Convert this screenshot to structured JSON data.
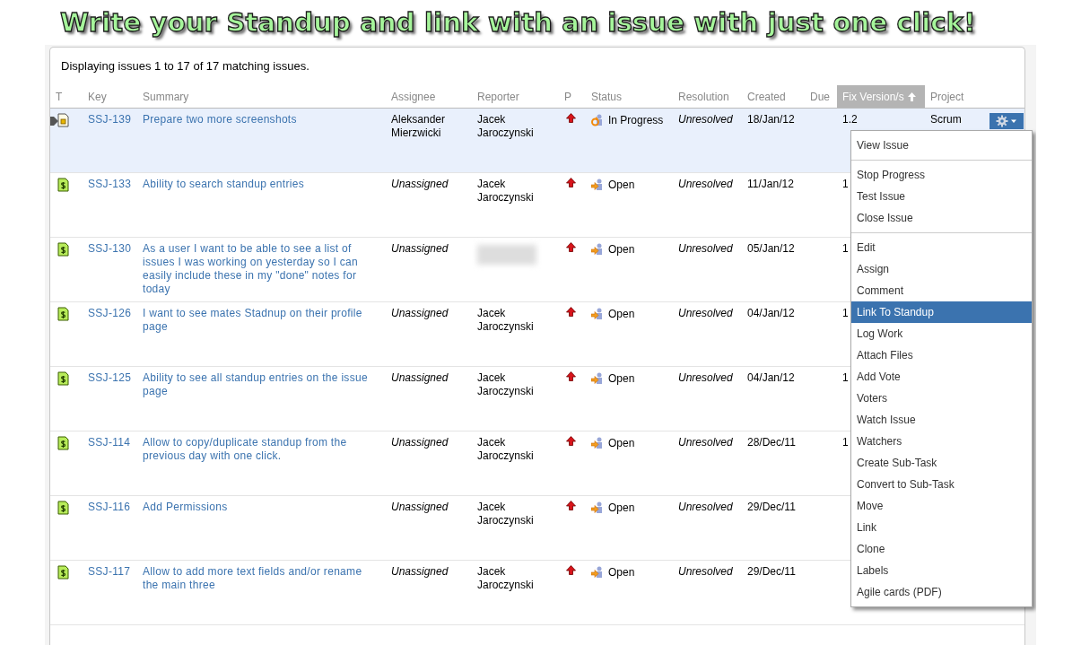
{
  "banner": {
    "title": "Write your Standup and link with an issue with just one click!"
  },
  "summary_text": "Displaying issues 1 to 17 of 17 matching issues.",
  "table": {
    "columns": [
      {
        "label": "T",
        "sorted": false
      },
      {
        "label": "Key",
        "sorted": false
      },
      {
        "label": "Summary",
        "sorted": false
      },
      {
        "label": "Assignee",
        "sorted": false
      },
      {
        "label": "Reporter",
        "sorted": false
      },
      {
        "label": "P",
        "sorted": false
      },
      {
        "label": "Status",
        "sorted": false
      },
      {
        "label": "Resolution",
        "sorted": false
      },
      {
        "label": "Created",
        "sorted": false
      },
      {
        "label": "Due",
        "sorted": false
      },
      {
        "label": "Fix Version/s",
        "sorted": true
      },
      {
        "label": "Project",
        "sorted": false
      }
    ],
    "rows": [
      {
        "selected": true,
        "issue_type": {
          "kind": "task"
        },
        "key": "SSJ-139",
        "summary": "Prepare two more screenshots",
        "assignee": "Aleksander Mierzwicki",
        "unassigned": false,
        "reporter": "Jacek Jaroczynski",
        "status": {
          "label": "In Progress",
          "kind": "in_progress"
        },
        "resolution": "Unresolved",
        "created": "18/Jan/12",
        "fix_version": "1.2",
        "project": "Scrum"
      },
      {
        "selected": false,
        "issue_type": {
          "kind": "story"
        },
        "key": "SSJ-133",
        "summary": "Ability to search standup entries",
        "assignee": "Unassigned",
        "unassigned": true,
        "reporter": "Jacek Jaroczynski",
        "status": {
          "label": "Open",
          "kind": "open"
        },
        "resolution": "Unresolved",
        "created": "11/Jan/12",
        "fix_version": "1"
      },
      {
        "selected": false,
        "issue_type": {
          "kind": "story"
        },
        "key": "SSJ-130",
        "summary": "As a user I want to be able to see a list of issues I was working on yesterday so I can easily include these in my \"done\" notes for today",
        "assignee": "Unassigned",
        "unassigned": true,
        "reporter_blurred": true,
        "status": {
          "label": "Open",
          "kind": "open"
        },
        "resolution": "Unresolved",
        "created": "05/Jan/12",
        "fix_version": "1"
      },
      {
        "selected": false,
        "issue_type": {
          "kind": "story"
        },
        "key": "SSJ-126",
        "summary": "I want to see mates Stadnup on their profile page",
        "assignee": "Unassigned",
        "unassigned": true,
        "reporter": "Jacek Jaroczynski",
        "status": {
          "label": "Open",
          "kind": "open"
        },
        "resolution": "Unresolved",
        "created": "04/Jan/12",
        "fix_version": "1"
      },
      {
        "selected": false,
        "issue_type": {
          "kind": "story"
        },
        "key": "SSJ-125",
        "summary": "Ability to see all standup entries on the issue page",
        "assignee": "Unassigned",
        "unassigned": true,
        "reporter": "Jacek Jaroczynski",
        "status": {
          "label": "Open",
          "kind": "open"
        },
        "resolution": "Unresolved",
        "created": "04/Jan/12",
        "fix_version": "1"
      },
      {
        "selected": false,
        "issue_type": {
          "kind": "story"
        },
        "key": "SSJ-114",
        "summary": "Allow to copy/duplicate standup from the previous day with one click.",
        "assignee": "Unassigned",
        "unassigned": true,
        "reporter": "Jacek Jaroczynski",
        "status": {
          "label": "Open",
          "kind": "open"
        },
        "resolution": "Unresolved",
        "created": "28/Dec/11",
        "fix_version": "1"
      },
      {
        "selected": false,
        "issue_type": {
          "kind": "story"
        },
        "key": "SSJ-116",
        "summary": "Add Permissions",
        "assignee": "Unassigned",
        "unassigned": true,
        "reporter": "Jacek Jaroczynski",
        "status": {
          "label": "Open",
          "kind": "open"
        },
        "resolution": "Unresolved",
        "created": "29/Dec/11"
      },
      {
        "selected": false,
        "issue_type": {
          "kind": "story"
        },
        "key": "SSJ-117",
        "summary": "Allow to add more text fields and/or rename the main three",
        "assignee": "Unassigned",
        "unassigned": true,
        "reporter": "Jacek Jaroczynski",
        "status": {
          "label": "Open",
          "kind": "open"
        },
        "resolution": "Unresolved",
        "created": "29/Dec/11"
      }
    ]
  },
  "actions_menu": {
    "groups": [
      [
        {
          "label": "View Issue",
          "selected": false
        }
      ],
      [
        {
          "label": "Stop Progress",
          "selected": false
        },
        {
          "label": "Test Issue",
          "selected": false
        },
        {
          "label": "Close Issue",
          "selected": false
        }
      ],
      [
        {
          "label": "Edit",
          "selected": false
        },
        {
          "label": "Assign",
          "selected": false
        },
        {
          "label": "Comment",
          "selected": false
        },
        {
          "label": "Link To Standup",
          "selected": true
        },
        {
          "label": "Log Work",
          "selected": false
        },
        {
          "label": "Attach Files",
          "selected": false
        },
        {
          "label": "Add Vote",
          "selected": false
        },
        {
          "label": "Voters",
          "selected": false
        },
        {
          "label": "Watch Issue",
          "selected": false
        },
        {
          "label": "Watchers",
          "selected": false
        },
        {
          "label": "Create Sub-Task",
          "selected": false
        },
        {
          "label": "Convert to Sub-Task",
          "selected": false
        },
        {
          "label": "Move",
          "selected": false
        },
        {
          "label": "Link",
          "selected": false
        },
        {
          "label": "Clone",
          "selected": false
        },
        {
          "label": "Labels",
          "selected": false
        },
        {
          "label": "Agile cards (PDF)",
          "selected": false
        }
      ]
    ]
  }
}
